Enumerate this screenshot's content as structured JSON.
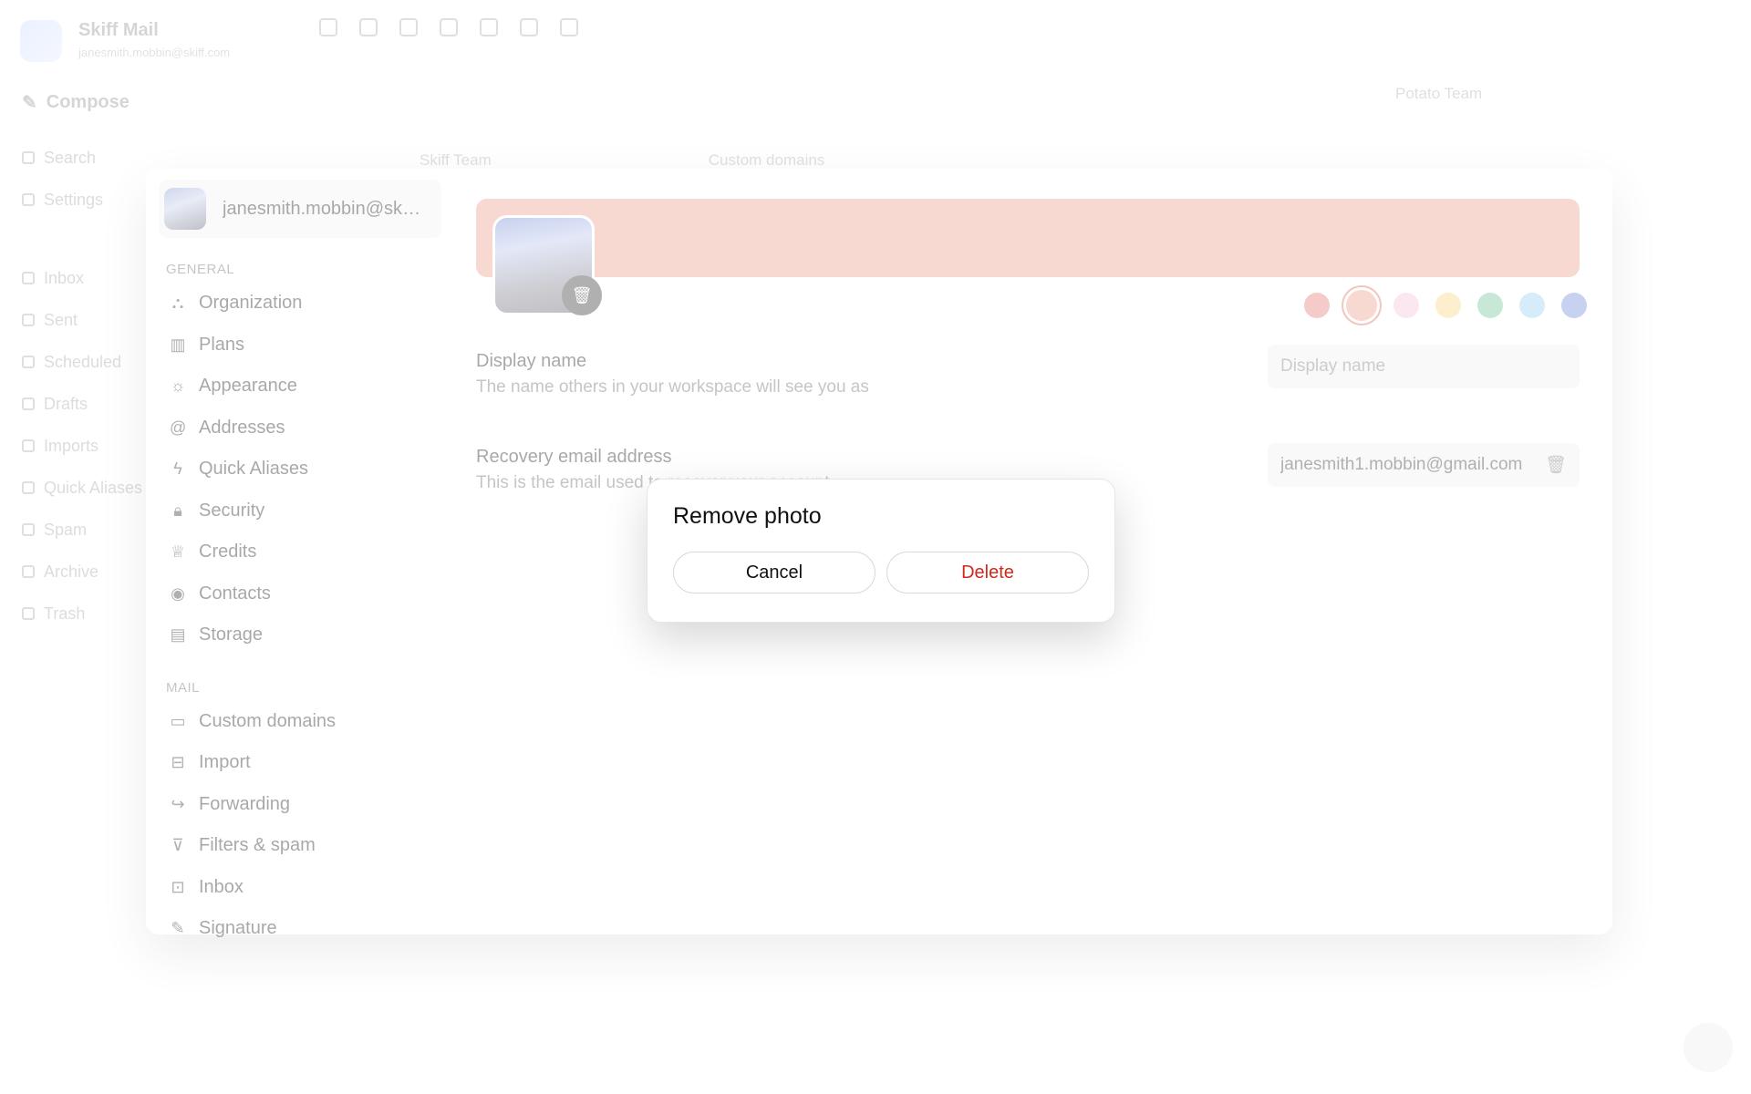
{
  "app": {
    "title": "Skiff Mail",
    "subtitle": "janesmith.mobbin@skiff.com",
    "compose_label": "Compose",
    "nav": [
      "Search",
      "Settings",
      "Inbox",
      "Sent",
      "Scheduled",
      "Drafts",
      "Imports",
      "Quick Aliases",
      "Spam",
      "Archive",
      "Trash"
    ]
  },
  "mail_strip": [
    "Skiff Team",
    "Custom domains",
    "Potato Team"
  ],
  "settings": {
    "account_name": "janesmith.mobbin@skiff.com",
    "general_label": "GENERAL",
    "general_items": [
      {
        "label": "Organization",
        "icon": "org-icon"
      },
      {
        "label": "Plans",
        "icon": "map-icon"
      },
      {
        "label": "Appearance",
        "icon": "sun-icon"
      },
      {
        "label": "Addresses",
        "icon": "at-icon"
      },
      {
        "label": "Quick Aliases",
        "icon": "bolt-icon"
      },
      {
        "label": "Security",
        "icon": "lock-icon"
      },
      {
        "label": "Credits",
        "icon": "trophy-icon"
      },
      {
        "label": "Contacts",
        "icon": "user-circle-icon"
      },
      {
        "label": "Storage",
        "icon": "database-icon"
      }
    ],
    "mail_label": "MAIL",
    "mail_items": [
      {
        "label": "Custom domains",
        "icon": "domain-icon"
      },
      {
        "label": "Import",
        "icon": "import-icon"
      },
      {
        "label": "Forwarding",
        "icon": "forward-icon"
      },
      {
        "label": "Filters & spam",
        "icon": "filter-icon"
      },
      {
        "label": "Inbox",
        "icon": "inbox-icon"
      },
      {
        "label": "Signature",
        "icon": "pen-icon"
      }
    ],
    "banner_color": "#f0a795",
    "swatch_colors": [
      "#e9857f",
      "#f0a795",
      "#f7c7dc",
      "#fbd88a",
      "#7ccaa0",
      "#9fd2f4",
      "#7b93dc"
    ],
    "display_name": {
      "title": "Display name",
      "description": "The name others in your workspace will see you as",
      "placeholder": "Display name"
    },
    "recovery": {
      "title": "Recovery email address",
      "description": "This is the email used to recover your account",
      "value": "janesmith1.mobbin@gmail.com"
    }
  },
  "dialog": {
    "title": "Remove photo",
    "cancel_label": "Cancel",
    "delete_label": "Delete",
    "delete_color": "#cf2a1b"
  }
}
